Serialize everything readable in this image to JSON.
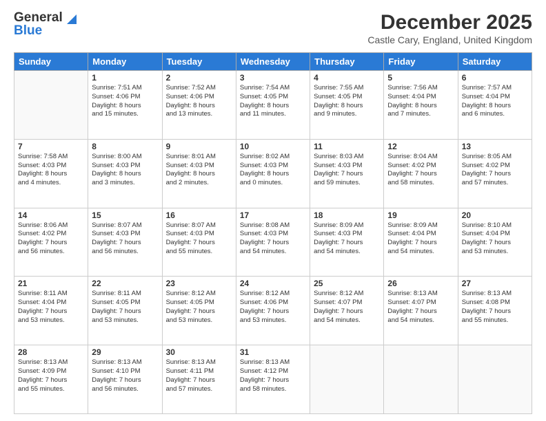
{
  "logo": {
    "line1": "General",
    "line2": "Blue"
  },
  "header": {
    "title": "December 2025",
    "location": "Castle Cary, England, United Kingdom"
  },
  "weekdays": [
    "Sunday",
    "Monday",
    "Tuesday",
    "Wednesday",
    "Thursday",
    "Friday",
    "Saturday"
  ],
  "weeks": [
    [
      {
        "day": "",
        "info": ""
      },
      {
        "day": "1",
        "info": "Sunrise: 7:51 AM\nSunset: 4:06 PM\nDaylight: 8 hours\nand 15 minutes."
      },
      {
        "day": "2",
        "info": "Sunrise: 7:52 AM\nSunset: 4:06 PM\nDaylight: 8 hours\nand 13 minutes."
      },
      {
        "day": "3",
        "info": "Sunrise: 7:54 AM\nSunset: 4:05 PM\nDaylight: 8 hours\nand 11 minutes."
      },
      {
        "day": "4",
        "info": "Sunrise: 7:55 AM\nSunset: 4:05 PM\nDaylight: 8 hours\nand 9 minutes."
      },
      {
        "day": "5",
        "info": "Sunrise: 7:56 AM\nSunset: 4:04 PM\nDaylight: 8 hours\nand 7 minutes."
      },
      {
        "day": "6",
        "info": "Sunrise: 7:57 AM\nSunset: 4:04 PM\nDaylight: 8 hours\nand 6 minutes."
      }
    ],
    [
      {
        "day": "7",
        "info": "Sunrise: 7:58 AM\nSunset: 4:03 PM\nDaylight: 8 hours\nand 4 minutes."
      },
      {
        "day": "8",
        "info": "Sunrise: 8:00 AM\nSunset: 4:03 PM\nDaylight: 8 hours\nand 3 minutes."
      },
      {
        "day": "9",
        "info": "Sunrise: 8:01 AM\nSunset: 4:03 PM\nDaylight: 8 hours\nand 2 minutes."
      },
      {
        "day": "10",
        "info": "Sunrise: 8:02 AM\nSunset: 4:03 PM\nDaylight: 8 hours\nand 0 minutes."
      },
      {
        "day": "11",
        "info": "Sunrise: 8:03 AM\nSunset: 4:03 PM\nDaylight: 7 hours\nand 59 minutes."
      },
      {
        "day": "12",
        "info": "Sunrise: 8:04 AM\nSunset: 4:02 PM\nDaylight: 7 hours\nand 58 minutes."
      },
      {
        "day": "13",
        "info": "Sunrise: 8:05 AM\nSunset: 4:02 PM\nDaylight: 7 hours\nand 57 minutes."
      }
    ],
    [
      {
        "day": "14",
        "info": "Sunrise: 8:06 AM\nSunset: 4:02 PM\nDaylight: 7 hours\nand 56 minutes."
      },
      {
        "day": "15",
        "info": "Sunrise: 8:07 AM\nSunset: 4:03 PM\nDaylight: 7 hours\nand 56 minutes."
      },
      {
        "day": "16",
        "info": "Sunrise: 8:07 AM\nSunset: 4:03 PM\nDaylight: 7 hours\nand 55 minutes."
      },
      {
        "day": "17",
        "info": "Sunrise: 8:08 AM\nSunset: 4:03 PM\nDaylight: 7 hours\nand 54 minutes."
      },
      {
        "day": "18",
        "info": "Sunrise: 8:09 AM\nSunset: 4:03 PM\nDaylight: 7 hours\nand 54 minutes."
      },
      {
        "day": "19",
        "info": "Sunrise: 8:09 AM\nSunset: 4:04 PM\nDaylight: 7 hours\nand 54 minutes."
      },
      {
        "day": "20",
        "info": "Sunrise: 8:10 AM\nSunset: 4:04 PM\nDaylight: 7 hours\nand 53 minutes."
      }
    ],
    [
      {
        "day": "21",
        "info": "Sunrise: 8:11 AM\nSunset: 4:04 PM\nDaylight: 7 hours\nand 53 minutes."
      },
      {
        "day": "22",
        "info": "Sunrise: 8:11 AM\nSunset: 4:05 PM\nDaylight: 7 hours\nand 53 minutes."
      },
      {
        "day": "23",
        "info": "Sunrise: 8:12 AM\nSunset: 4:05 PM\nDaylight: 7 hours\nand 53 minutes."
      },
      {
        "day": "24",
        "info": "Sunrise: 8:12 AM\nSunset: 4:06 PM\nDaylight: 7 hours\nand 53 minutes."
      },
      {
        "day": "25",
        "info": "Sunrise: 8:12 AM\nSunset: 4:07 PM\nDaylight: 7 hours\nand 54 minutes."
      },
      {
        "day": "26",
        "info": "Sunrise: 8:13 AM\nSunset: 4:07 PM\nDaylight: 7 hours\nand 54 minutes."
      },
      {
        "day": "27",
        "info": "Sunrise: 8:13 AM\nSunset: 4:08 PM\nDaylight: 7 hours\nand 55 minutes."
      }
    ],
    [
      {
        "day": "28",
        "info": "Sunrise: 8:13 AM\nSunset: 4:09 PM\nDaylight: 7 hours\nand 55 minutes."
      },
      {
        "day": "29",
        "info": "Sunrise: 8:13 AM\nSunset: 4:10 PM\nDaylight: 7 hours\nand 56 minutes."
      },
      {
        "day": "30",
        "info": "Sunrise: 8:13 AM\nSunset: 4:11 PM\nDaylight: 7 hours\nand 57 minutes."
      },
      {
        "day": "31",
        "info": "Sunrise: 8:13 AM\nSunset: 4:12 PM\nDaylight: 7 hours\nand 58 minutes."
      },
      {
        "day": "",
        "info": ""
      },
      {
        "day": "",
        "info": ""
      },
      {
        "day": "",
        "info": ""
      }
    ]
  ]
}
